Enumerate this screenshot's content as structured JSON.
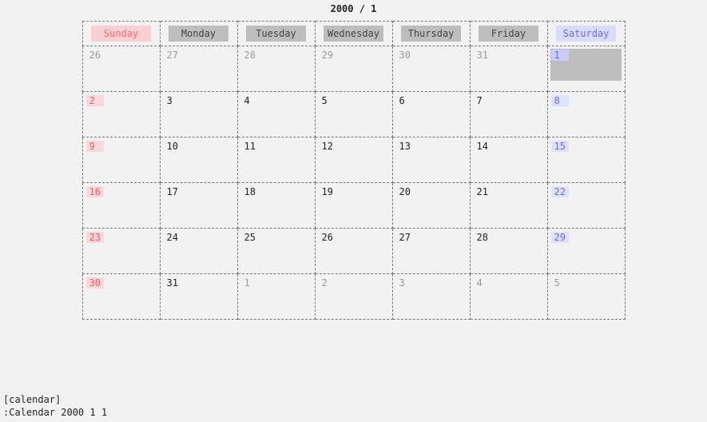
{
  "title": "2000 /  1",
  "day_headers": [
    "Sunday",
    "Monday",
    "Tuesday",
    "Wednesday",
    "Thursday",
    "Friday",
    "Saturday"
  ],
  "weeks": [
    [
      {
        "n": "26",
        "in": false,
        "today": false
      },
      {
        "n": "27",
        "in": false,
        "today": false
      },
      {
        "n": "28",
        "in": false,
        "today": false
      },
      {
        "n": "29",
        "in": false,
        "today": false
      },
      {
        "n": "30",
        "in": false,
        "today": false
      },
      {
        "n": "31",
        "in": false,
        "today": false
      },
      {
        "n": "1",
        "in": true,
        "today": true
      }
    ],
    [
      {
        "n": "2",
        "in": true,
        "today": false
      },
      {
        "n": "3",
        "in": true,
        "today": false
      },
      {
        "n": "4",
        "in": true,
        "today": false
      },
      {
        "n": "5",
        "in": true,
        "today": false
      },
      {
        "n": "6",
        "in": true,
        "today": false
      },
      {
        "n": "7",
        "in": true,
        "today": false
      },
      {
        "n": "8",
        "in": true,
        "today": false
      }
    ],
    [
      {
        "n": "9",
        "in": true,
        "today": false
      },
      {
        "n": "10",
        "in": true,
        "today": false
      },
      {
        "n": "11",
        "in": true,
        "today": false
      },
      {
        "n": "12",
        "in": true,
        "today": false
      },
      {
        "n": "13",
        "in": true,
        "today": false
      },
      {
        "n": "14",
        "in": true,
        "today": false
      },
      {
        "n": "15",
        "in": true,
        "today": false
      }
    ],
    [
      {
        "n": "16",
        "in": true,
        "today": false
      },
      {
        "n": "17",
        "in": true,
        "today": false
      },
      {
        "n": "18",
        "in": true,
        "today": false
      },
      {
        "n": "19",
        "in": true,
        "today": false
      },
      {
        "n": "20",
        "in": true,
        "today": false
      },
      {
        "n": "21",
        "in": true,
        "today": false
      },
      {
        "n": "22",
        "in": true,
        "today": false
      }
    ],
    [
      {
        "n": "23",
        "in": true,
        "today": false
      },
      {
        "n": "24",
        "in": true,
        "today": false
      },
      {
        "n": "25",
        "in": true,
        "today": false
      },
      {
        "n": "26",
        "in": true,
        "today": false
      },
      {
        "n": "27",
        "in": true,
        "today": false
      },
      {
        "n": "28",
        "in": true,
        "today": false
      },
      {
        "n": "29",
        "in": true,
        "today": false
      }
    ],
    [
      {
        "n": "30",
        "in": true,
        "today": false
      },
      {
        "n": "31",
        "in": true,
        "today": false
      },
      {
        "n": "1",
        "in": false,
        "today": false
      },
      {
        "n": "2",
        "in": false,
        "today": false
      },
      {
        "n": "3",
        "in": false,
        "today": false
      },
      {
        "n": "4",
        "in": false,
        "today": false
      },
      {
        "n": "5",
        "in": false,
        "today": false
      }
    ]
  ],
  "status": {
    "mode": "[calendar]",
    "cmd": ":Calendar 2000 1 1"
  }
}
